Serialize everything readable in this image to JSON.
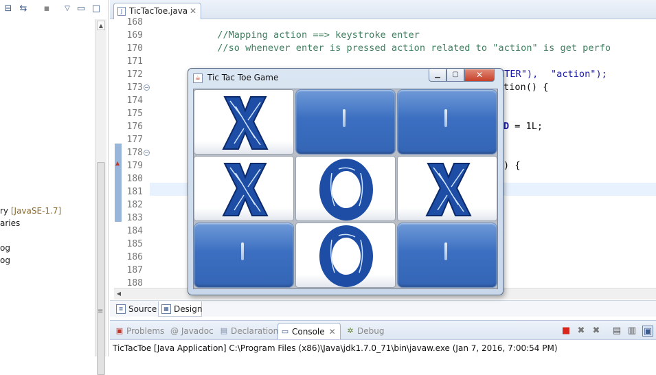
{
  "package_explorer": {
    "tree": [
      {
        "label": "ry ",
        "extra": "[JavaSE-1.7]"
      },
      {
        "label": "aries",
        "extra": ""
      },
      {
        "label": "",
        "extra": ""
      },
      {
        "label": "og",
        "extra": ""
      },
      {
        "label": "og",
        "extra": ""
      }
    ],
    "icons": [
      "collapse-all-icon",
      "link-with-editor-icon",
      "view-menu-icon",
      "minimize-icon",
      "maximize-icon"
    ]
  },
  "editor": {
    "tab_label": "TicTacToe.java",
    "line_numbers": [
      "168",
      "169",
      "170",
      "171",
      "172",
      "173",
      "174",
      "175",
      "176",
      "177",
      "178",
      "179",
      "180",
      "181",
      "182",
      "183",
      "184",
      "185",
      "186",
      "187",
      "188"
    ],
    "code_lines": [
      "",
      "            //Mapping action ==> keystroke enter",
      "            //so whenever enter is pressed action related to \"action\" is get perfo",
      "",
      "",
      "",
      "",
      "",
      "",
      "",
      "",
      "",
      "",
      "",
      "",
      "",
      "",
      "",
      "",
      "",
      "        }"
    ],
    "partial_line_172_a": "NTER\"),",
    "partial_line_172_b": "\"action\");",
    "partial_line_173": "tion() {",
    "partial_line_176_kw": "D",
    "partial_line_176": " = 1L;",
    "partial_line_179": ") {"
  },
  "design_tabs": {
    "source": "Source",
    "design": "Design"
  },
  "console": {
    "tabs": [
      {
        "label": "Problems",
        "icon": "problems-icon"
      },
      {
        "label": "@ Javadoc",
        "icon": "javadoc-icon"
      },
      {
        "label": "Declaration",
        "icon": "declaration-icon"
      },
      {
        "label": "Console",
        "icon": "console-icon"
      },
      {
        "label": "Debug",
        "icon": "debug-icon"
      }
    ],
    "status": "TicTacToe [Java Application] C:\\Program Files (x86)\\Java\\jdk1.7.0_71\\bin\\javaw.exe (Jan 7, 2016, 7:00:54 PM)"
  },
  "game_window": {
    "title": "Tic Tac Toe Game",
    "board": [
      [
        "X",
        "",
        ""
      ],
      [
        "X",
        "O",
        "X"
      ],
      [
        "",
        "O",
        ""
      ]
    ],
    "colors": {
      "x_fill": "#1e4da6",
      "o_fill": "#1e4da6",
      "empty_cell": "#3c6fc1"
    }
  }
}
